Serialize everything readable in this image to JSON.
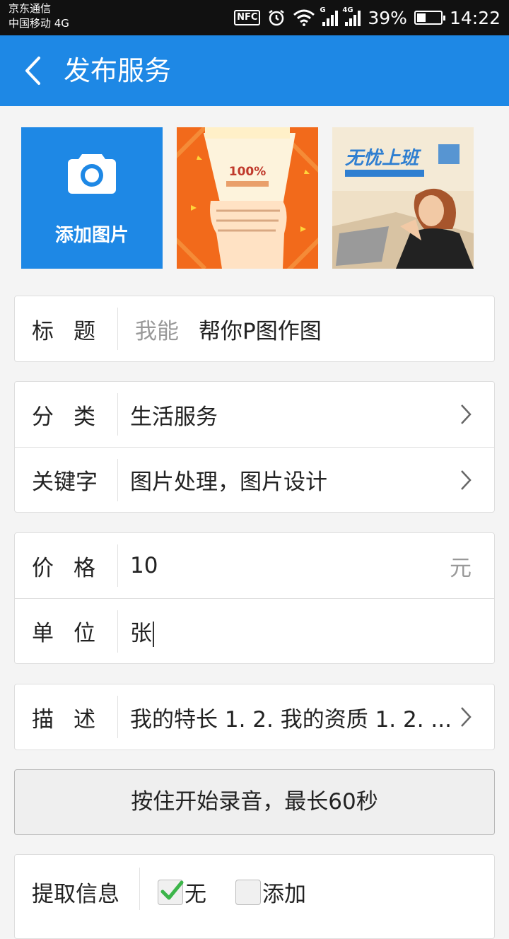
{
  "status_bar": {
    "carrier_1": "京东通信",
    "carrier_2": "中国移动 4G",
    "nfc": "NFC",
    "net_1": "G",
    "net_2": "4G",
    "battery": "39%",
    "battery_level": 0.39,
    "time": "14:22"
  },
  "header": {
    "title": "发布服务",
    "back_icon": "chevron-left-icon"
  },
  "images": {
    "add_label": "添加图片",
    "add_icon": "camera-icon",
    "thumb_1_text": "100%",
    "thumb_2_text": "无忧上班"
  },
  "form": {
    "title_label": "标题",
    "title_hint": "我能",
    "title_value": "帮你P图作图",
    "category_label": "分类",
    "category_value": "生活服务",
    "keyword_label": "关键字",
    "keyword_value": "图片处理，图片设计",
    "price_label": "价格",
    "price_value": "10",
    "price_unit": "元",
    "unit_label": "单位",
    "unit_value": "张",
    "desc_label": "描述",
    "desc_value": "我的特长 1. 2.  我的资质 1. 2. ..."
  },
  "record_button": "按住开始录音，最长60秒",
  "extract": {
    "label": "提取信息",
    "option_none": "无",
    "option_none_checked": true,
    "option_add": "添加",
    "option_add_checked": false
  },
  "colors": {
    "primary": "#1e88e5",
    "check": "#3cb54a",
    "status_bar": "#111111"
  }
}
